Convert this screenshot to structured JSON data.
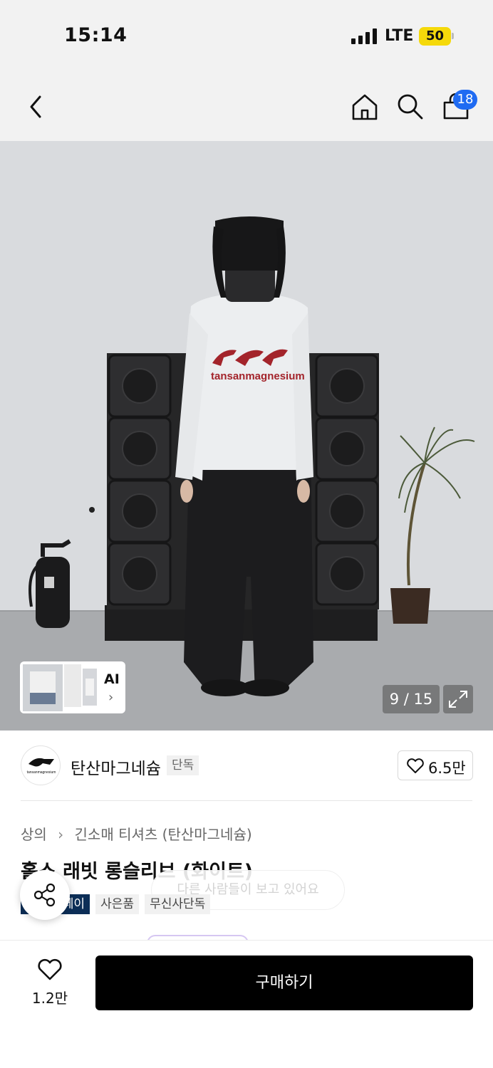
{
  "status_bar": {
    "time": "15:14",
    "network": "LTE",
    "battery": "50"
  },
  "header": {
    "back_icon": "chevron-left-icon",
    "home_icon": "home-icon",
    "search_icon": "search-icon",
    "cart_icon": "shopping-bag-icon",
    "cart_count": "18"
  },
  "gallery": {
    "ai_label": "AI",
    "counter": "9 / 15",
    "expand_icon": "expand-icon",
    "shirt_print_text": "tansanmagnesium"
  },
  "brand": {
    "logo_text": "tansanmagnesium",
    "name": "탄산마그네슘",
    "badge": "단독",
    "likes": "6.5만"
  },
  "product": {
    "breadcrumb": [
      "상의",
      "긴소매 티셔츠 (탄산마그네슘)"
    ],
    "title": "홀스 래빗 롱슬리브 (화이트)",
    "tooltip": "다른 사람들이 보고 있어요",
    "tags": [
      "무신사페이",
      "사은품",
      "무신사단독"
    ]
  },
  "bottom_bar": {
    "wish_count": "1.2만",
    "buy_label": "구매하기"
  },
  "colors": {
    "accent_blue": "#1f6bf2",
    "battery_yellow": "#f5d90a",
    "tag_navy": "#0c2e57",
    "shirt_print_red": "#a3242b"
  }
}
